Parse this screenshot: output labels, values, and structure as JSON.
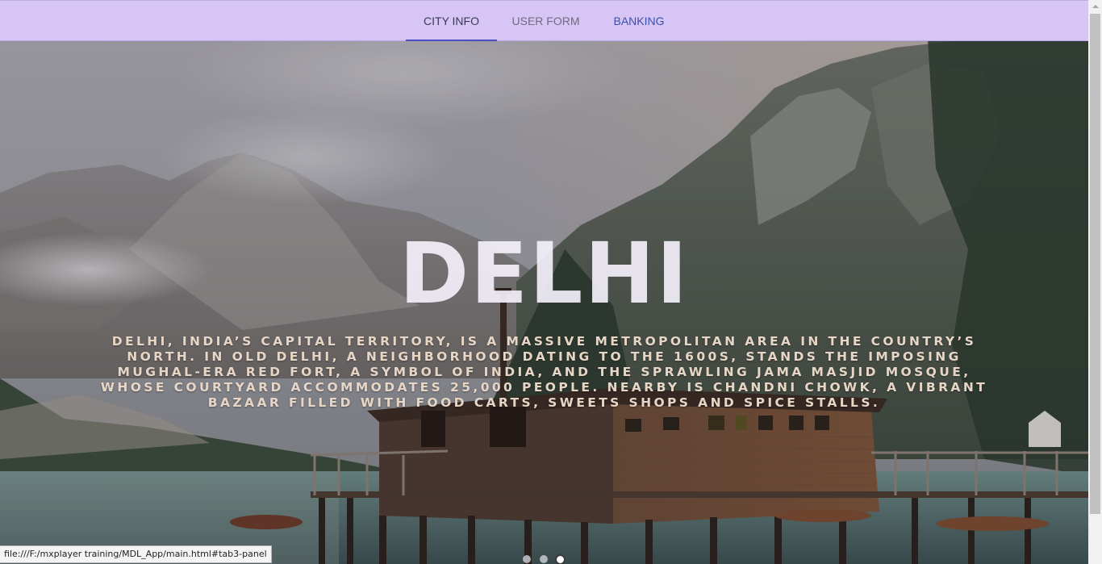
{
  "tabs": [
    {
      "label": "CITY INFO",
      "active": true
    },
    {
      "label": "USER FORM",
      "active": false
    },
    {
      "label": "BANKING",
      "active": false
    }
  ],
  "hero": {
    "title": "DELHI",
    "description": "Delhi, India’s capital territory, is a massive metropolitan area in the country’s north. In Old Delhi, a neighborhood dating to the 1600s, stands the imposing Mughal-era Red Fort, a symbol of India, and the sprawling Jama Masjid mosque, whose courtyard accommodates 25,000 people. Nearby is Chandni Chowk, a vibrant bazaar filled with food carts, sweets shops and spice stalls."
  },
  "carousel": {
    "total_slides": 3,
    "active_slide": 3
  },
  "status_bar": {
    "url": "file:///F:/mxplayer training/MDL_App/main.html#tab3-panel"
  },
  "colors": {
    "tabbar_bg": "#d6c5f5",
    "tab_indicator": "#4a4fc4",
    "banking_tab_text": "#3d4fa8",
    "description_text": "#e7d6c6"
  },
  "icons": {
    "background_image": "mountain-lake-cabin-image"
  }
}
